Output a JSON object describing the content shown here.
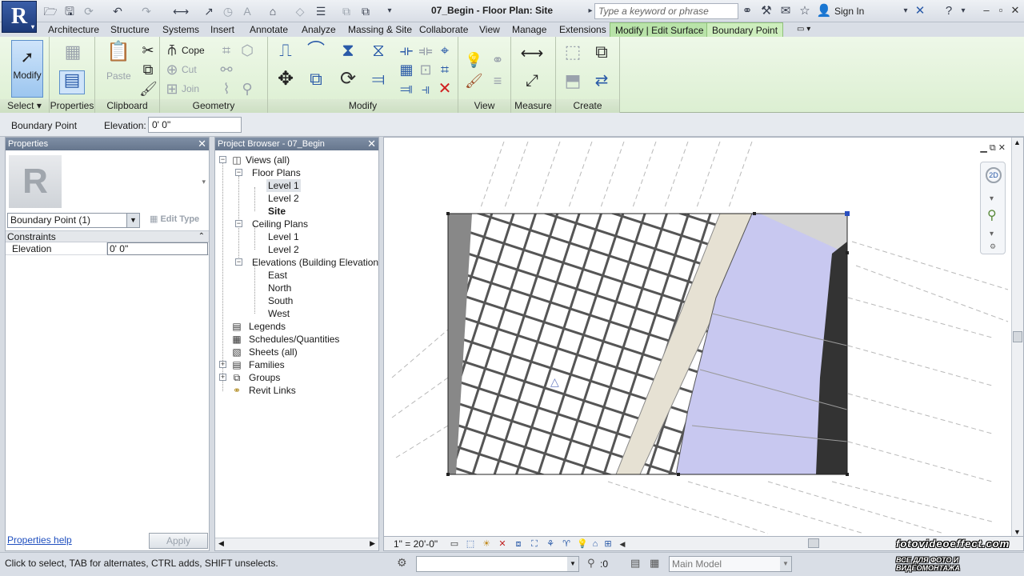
{
  "titlebar": {
    "doc_title": "07_Begin - Floor Plan: Site",
    "search_placeholder": "Type a keyword or phrase",
    "sign_in": "Sign In"
  },
  "ribbon": {
    "tabs": [
      "Architecture",
      "Structure",
      "Systems",
      "Insert",
      "Annotate",
      "Analyze",
      "Massing & Site",
      "Collaborate",
      "View",
      "Manage",
      "Extensions",
      "Modify | Edit Surface",
      "Boundary Point"
    ],
    "active_tab": "Boundary Point",
    "modify_label": "Modify",
    "cope_label": "Cope",
    "paste_label": "Paste",
    "cut_label": "Cut",
    "join_label": "Join",
    "panels": {
      "select": "Select",
      "properties": "Properties",
      "clipboard": "Clipboard",
      "geometry": "Geometry",
      "modify": "Modify",
      "view": "View",
      "measure": "Measure",
      "create": "Create"
    }
  },
  "optionsbar": {
    "context": "Boundary Point",
    "elevation_label": "Elevation:",
    "elevation_value": "0' 0\""
  },
  "properties": {
    "title": "Properties",
    "type_selector": "Boundary Point (1)",
    "edit_type": "Edit Type",
    "group": "Constraints",
    "param_name": "Elevation",
    "param_value": "0' 0\"",
    "help_link": "Properties help",
    "apply": "Apply"
  },
  "browser": {
    "title": "Project Browser - 07_Begin",
    "items": {
      "views": "Views (all)",
      "floor_plans": "Floor Plans",
      "fp_level1": "Level 1",
      "fp_level2": "Level 2",
      "fp_site": "Site",
      "ceiling_plans": "Ceiling Plans",
      "cp_level1": "Level 1",
      "cp_level2": "Level 2",
      "elevations": "Elevations (Building Elevation)",
      "east": "East",
      "north": "North",
      "south": "South",
      "west": "West",
      "legends": "Legends",
      "schedules": "Schedules/Quantities",
      "sheets": "Sheets (all)",
      "families": "Families",
      "groups": "Groups",
      "revit_links": "Revit Links"
    }
  },
  "view": {
    "scale": "1\" = 20'-0\"",
    "nav_2d": "2D"
  },
  "statusbar": {
    "hint": "Click to select, TAB for alternates, CTRL adds, SHIFT unselects.",
    "count": ":0",
    "model": "Main Model"
  },
  "watermark": {
    "line1": "fotovideoeffect.com",
    "line2": "ВСЕ ДЛЯ ФОТО И ВИДЕОМОНТАЖА"
  },
  "colors": {
    "context_tab": "#b9e3a9",
    "ribbon_bg": "#e3f3da",
    "panel_header": "#7f8fa5",
    "toposurface": "#c8c8f0",
    "road": "#e6e1d3"
  }
}
